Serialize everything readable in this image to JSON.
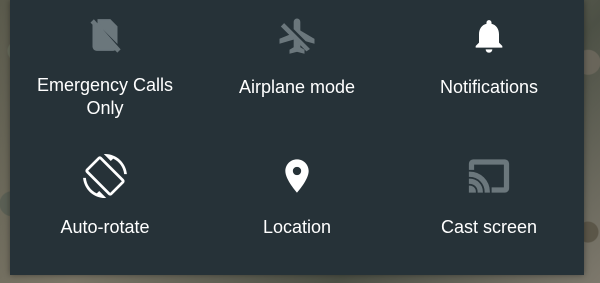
{
  "quick_settings": {
    "tiles": [
      {
        "label": "Emergency Calls\nOnly",
        "icon": "no-sim-icon",
        "state": "inactive"
      },
      {
        "label": "Airplane mode",
        "icon": "airplane-off-icon",
        "state": "inactive"
      },
      {
        "label": "Notifications",
        "icon": "bell-icon",
        "state": "active"
      },
      {
        "label": "Auto-rotate",
        "icon": "screen-rotation-icon",
        "state": "active"
      },
      {
        "label": "Location",
        "icon": "location-pin-icon",
        "state": "active"
      },
      {
        "label": "Cast screen",
        "icon": "cast-icon",
        "state": "inactive"
      }
    ]
  },
  "colors": {
    "panel_background": "#263238",
    "active_icon": "#ffffff",
    "inactive_icon": "#6b777c",
    "label_text": "#ffffff"
  }
}
